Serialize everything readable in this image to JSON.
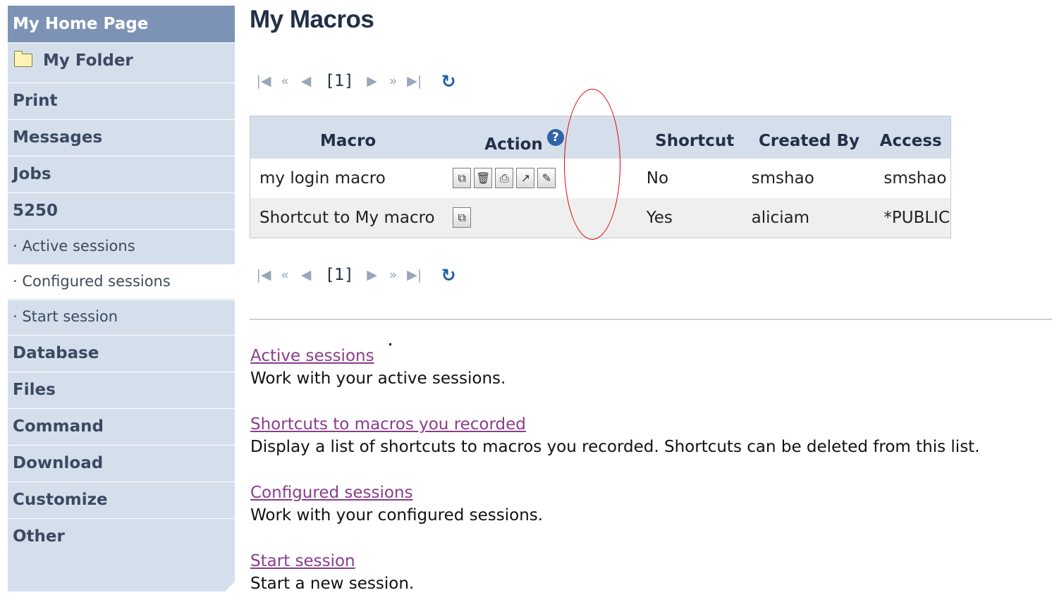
{
  "sidebar": {
    "home": "My Home Page",
    "folder": "My Folder",
    "items": [
      "Print",
      "Messages",
      "Jobs",
      "5250"
    ],
    "sub_items": [
      "· Active sessions",
      "· Configured sessions",
      "· Start session"
    ],
    "items2": [
      "Database",
      "Files",
      "Command",
      "Download",
      "Customize",
      "Other"
    ]
  },
  "page_title": "My Macros",
  "pager": {
    "first": "|◀",
    "prev_many": "«",
    "prev": "◀",
    "page": "[1]",
    "next": "▶",
    "next_many": "»",
    "last": "▶|",
    "refresh": "↻"
  },
  "table": {
    "headers": [
      "Macro",
      "Action",
      "Shortcut",
      "Created By",
      "Access"
    ],
    "help_icon": "?",
    "rows": [
      {
        "macro": "my login macro",
        "shortcut": "No",
        "created_by": "smshao",
        "access": "smshao",
        "actions": [
          "copy-icon",
          "delete-icon",
          "print-icon",
          "shortcut-icon",
          "edit-icon"
        ]
      },
      {
        "macro": "Shortcut to My macro",
        "shortcut": "Yes",
        "created_by": "aliciam",
        "access": "*PUBLIC",
        "actions": [
          "copy-icon"
        ]
      }
    ]
  },
  "links": [
    {
      "label": "Active sessions",
      "desc": "Work with your active sessions."
    },
    {
      "label": "Shortcuts to macros you recorded",
      "desc": "Display a list of shortcuts to macros you recorded. Shortcuts can be deleted from this list."
    },
    {
      "label": "Configured sessions",
      "desc": "Work with your configured sessions."
    },
    {
      "label": "Start session",
      "desc": "Start a new session."
    }
  ],
  "colors": {
    "sidebar_bg": "#d5dfec",
    "sidebar_header": "#7d93b6",
    "link_visited": "#8b3c8c",
    "annotation": "#e00000"
  }
}
